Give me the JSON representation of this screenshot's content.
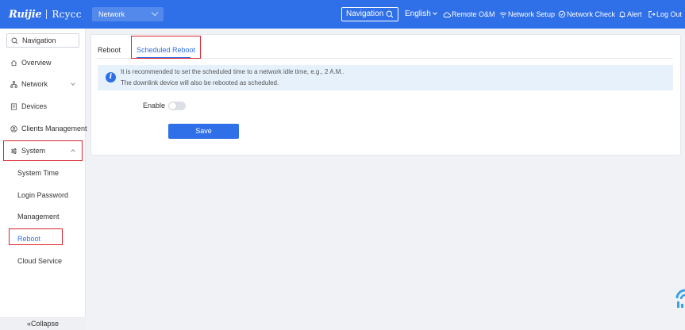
{
  "header": {
    "logo_main": "Ruijie",
    "logo_sub": "Rcycc",
    "network_select": "Network",
    "navigation_label": "Navigation",
    "language": "English",
    "items": {
      "remote_om": "Remote O&M",
      "network_setup": "Network Setup",
      "network_check": "Network Check",
      "alert": "Alert",
      "logout": "Log Out"
    }
  },
  "sidebar": {
    "navigation_label": "Navigation",
    "items": {
      "overview": "Overview",
      "network": "Network",
      "devices": "Devices",
      "clients": "Clients Management",
      "system": "System"
    },
    "system_subitems": {
      "system_time": "System Time",
      "login_password": "Login Password",
      "management": "Management",
      "reboot": "Reboot",
      "cloud_service": "Cloud Service"
    },
    "collapse_label": "Collapse"
  },
  "main": {
    "tabs": {
      "reboot": "Reboot",
      "scheduled_reboot": "Scheduled Reboot"
    },
    "tip": {
      "icon": "i",
      "line1": "It is recommended to set the scheduled time to a network idle time, e.g., 2 A.M..",
      "line2": "The downlink device will also be rebooted as scheduled."
    },
    "enable_label": "Enable",
    "enable_on": false,
    "save_label": "Save"
  },
  "colors": {
    "accent": "#2f6fe8",
    "highlight_box": "#d9232d",
    "tip_background": "#e6f1fc"
  }
}
